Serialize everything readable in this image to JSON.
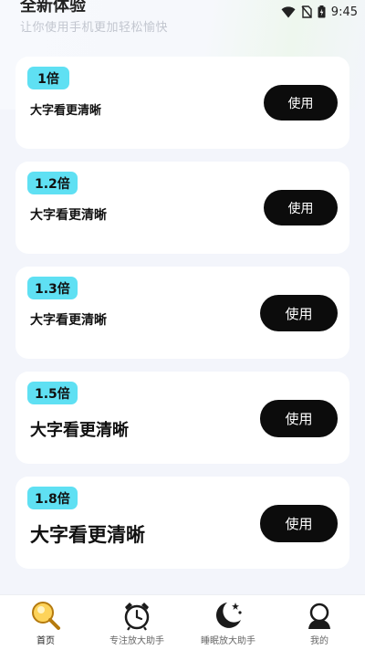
{
  "status_bar": {
    "time": "9:45"
  },
  "header": {
    "title": "全新体验",
    "subtitle": "让你使用手机更加轻松愉快"
  },
  "cards": [
    {
      "badge": "1倍",
      "text": "大字看更清晰",
      "button": "使用"
    },
    {
      "badge": "1.2倍",
      "text": "大字看更清晰",
      "button": "使用"
    },
    {
      "badge": "1.3倍",
      "text": "大字看更清晰",
      "button": "使用"
    },
    {
      "badge": "1.5倍",
      "text": "大字看更清晰",
      "button": "使用"
    },
    {
      "badge": "1.8倍",
      "text": "大字看更清晰",
      "button": "使用"
    }
  ],
  "nav": [
    {
      "label": "首页",
      "icon": "magnifier-icon",
      "active": true
    },
    {
      "label": "专注放大助手",
      "icon": "alarm-clock-icon",
      "active": false
    },
    {
      "label": "睡眠放大助手",
      "icon": "moon-stars-icon",
      "active": false
    },
    {
      "label": "我的",
      "icon": "user-icon",
      "active": false
    }
  ],
  "colors": {
    "accent": "#5fe0f3",
    "button": "#0c0c0c",
    "background": "#f3f5fb"
  }
}
